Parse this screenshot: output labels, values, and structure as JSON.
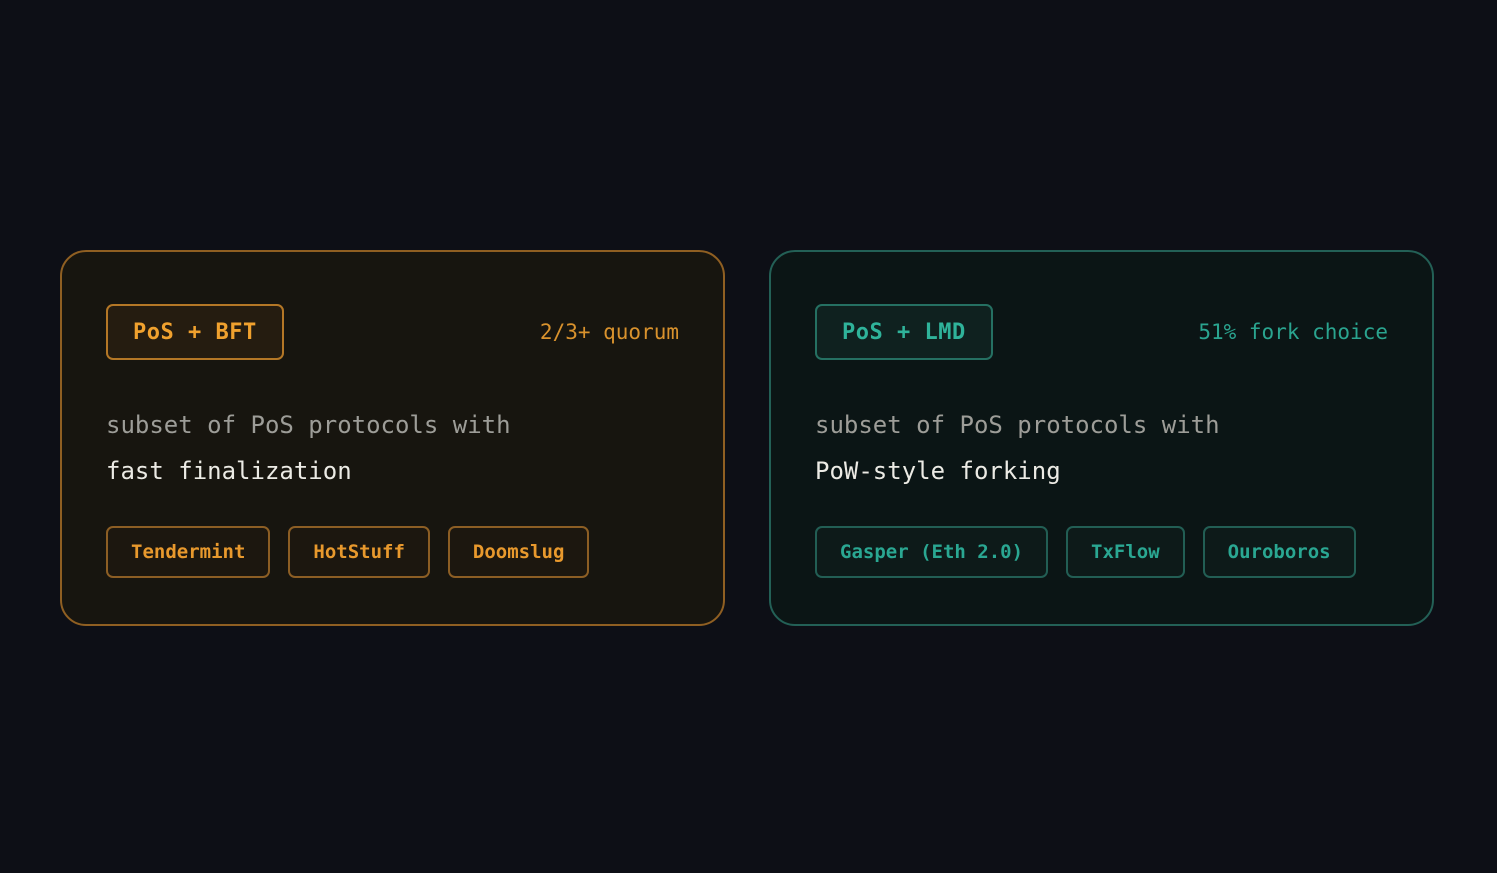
{
  "cards": [
    {
      "badge": "PoS + BFT",
      "note": "2/3+ quorum",
      "line1": "subset of PoS protocols with",
      "line2": "fast finalization",
      "tags": [
        "Tendermint",
        "HotStuff",
        "Doomslug"
      ],
      "accent": "#f0a12e"
    },
    {
      "badge": "PoS + LMD",
      "note": "51% fork choice",
      "line1": "subset of PoS protocols with",
      "line2": "PoW-style forking",
      "tags": [
        "Gasper (Eth 2.0)",
        "TxFlow",
        "Ouroboros"
      ],
      "accent": "#2fb39a"
    }
  ]
}
